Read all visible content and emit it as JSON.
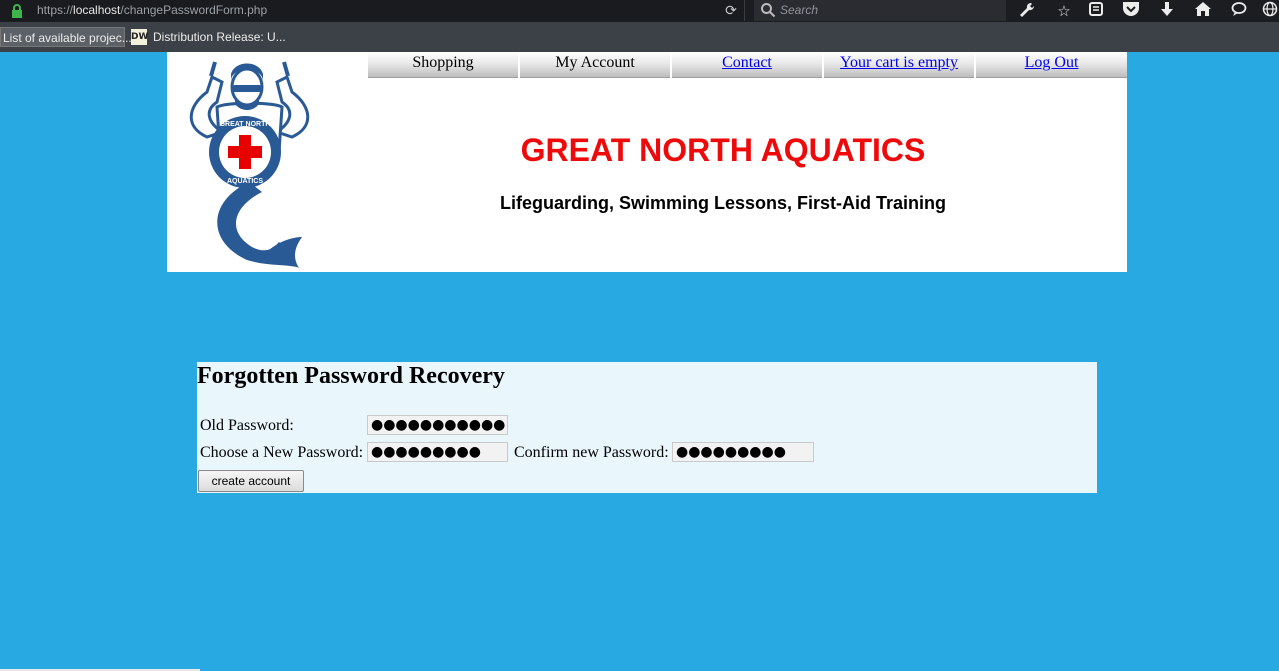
{
  "browser": {
    "url_prefix": "https://",
    "url_host": "localhost",
    "url_path": "/changePasswordForm.php",
    "search_placeholder": "Search",
    "bookmarks": [
      {
        "label": "List of available projec..."
      },
      {
        "label": "Distribution Release: U...",
        "icon_text": "DW"
      }
    ],
    "toolbar_icons": [
      "wrench-icon",
      "star-icon",
      "reading-list-icon",
      "pocket-icon",
      "download-icon",
      "home-icon",
      "chat-icon",
      "globe-icon"
    ]
  },
  "nav": {
    "items": [
      {
        "label": "Shopping",
        "link": false
      },
      {
        "label": "My Account",
        "link": false
      },
      {
        "label": "Contact",
        "link": true
      },
      {
        "label": "Your cart is empty",
        "link": true
      },
      {
        "label": "Log Out",
        "link": true
      }
    ]
  },
  "header": {
    "title": "GREAT NORTH AQUATICS",
    "tagline": "Lifeguarding, Swimming Lessons, First-Aid Training",
    "logo_text_top": "GREAT NORTH",
    "logo_text_bottom": "AQUATICS"
  },
  "form": {
    "heading": "Forgotten Password Recovery",
    "old_password_label": "Old Password:",
    "old_password_value": "●●●●●●●●●●●",
    "new_password_label": "Choose a New Password:",
    "new_password_value": "●●●●●●●●●",
    "confirm_password_label": "Confirm new Password:",
    "confirm_password_value": "●●●●●●●●●",
    "submit_label": "create account"
  },
  "colors": {
    "page_background": "#29a9e1",
    "title_red": "#ee0a0a",
    "form_background": "#e9f6fc",
    "logo_blue": "#2a5a95"
  }
}
